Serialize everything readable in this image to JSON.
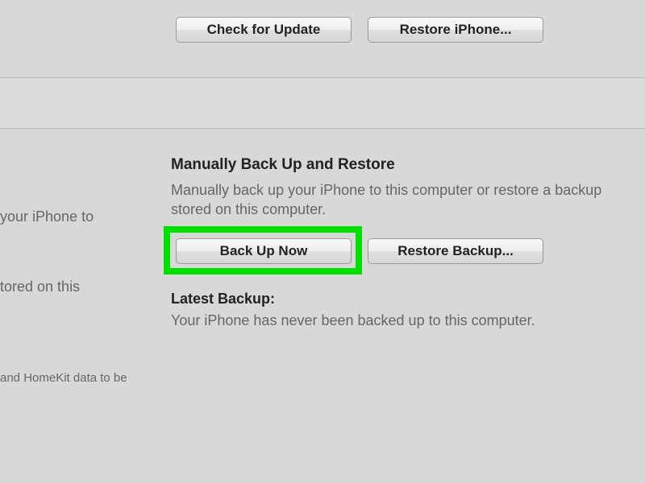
{
  "top": {
    "check_update_label": "Check for Update",
    "restore_iphone_label": "Restore iPhone..."
  },
  "left_fragments": {
    "line1": "your iPhone to",
    "line2": "tored on this",
    "line3": "and HomeKit data to be"
  },
  "backup": {
    "title": "Manually Back Up and Restore",
    "desc": "Manually back up your iPhone to this computer or restore a backup stored on this computer.",
    "back_up_now_label": "Back Up Now",
    "restore_backup_label": "Restore Backup...",
    "latest_title": "Latest Backup:",
    "latest_text": "Your iPhone has never been backed up to this computer."
  }
}
